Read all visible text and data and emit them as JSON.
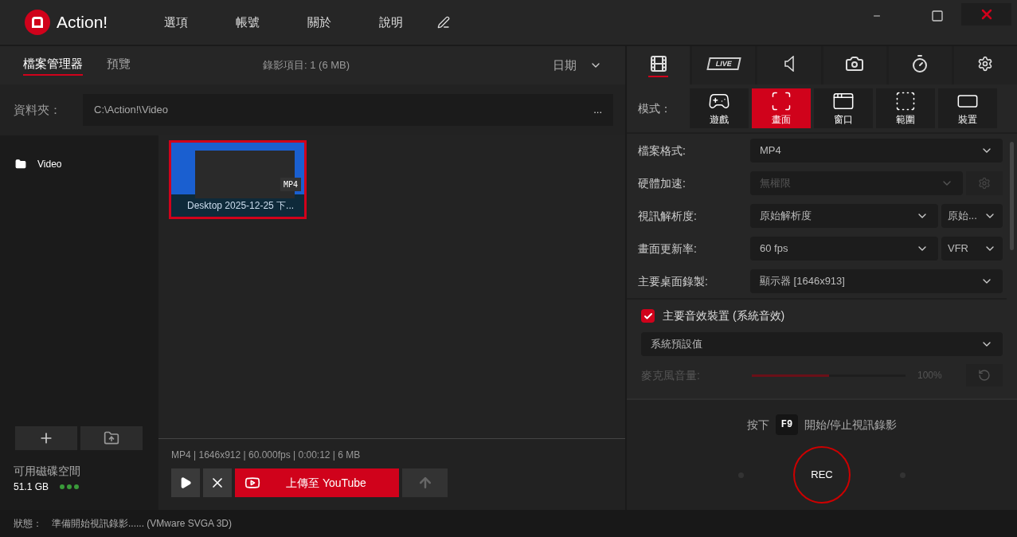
{
  "title_bar": {
    "app_name": "Action!",
    "menu": [
      "選項",
      "帳號",
      "關於",
      "說明"
    ]
  },
  "file_panel": {
    "tabs": [
      {
        "label": "檔案管理器",
        "selected": true
      },
      {
        "label": "預覽",
        "selected": false
      }
    ],
    "record_count": "錄影項目: 1 (6 MB)",
    "sort": "日期",
    "folder": {
      "label": "資料夾：",
      "value": "C:\\Action!\\Video",
      "more": "..."
    },
    "folders": [
      {
        "name": "Video"
      }
    ],
    "disk": {
      "label": "可用磁碟空間",
      "value": "51.1 GB"
    },
    "recordings": [
      {
        "title": "Desktop 2025-12-25 下...",
        "format": "MP4",
        "selected": true
      }
    ],
    "info": "MP4 | 1646x912 | 60.000fps | 0:00:12 | 6 MB",
    "upload_button": "上傳至 YouTube"
  },
  "settings_panel": {
    "tabs": [
      {
        "kind": "video",
        "selected": true
      },
      {
        "kind": "live",
        "label": "LIVE",
        "selected": false
      },
      {
        "kind": "audio",
        "selected": false
      },
      {
        "kind": "screenshot",
        "selected": false
      },
      {
        "kind": "timer",
        "selected": false
      },
      {
        "kind": "settings",
        "selected": false
      }
    ],
    "mode_label": "模式：",
    "modes": [
      {
        "kind": "game",
        "label": "遊戲",
        "selected": false
      },
      {
        "kind": "screen",
        "label": "畫面",
        "selected": true
      },
      {
        "kind": "window",
        "label": "窗口",
        "selected": false
      },
      {
        "kind": "region",
        "label": "範圍",
        "selected": false
      },
      {
        "kind": "device",
        "label": "裝置",
        "selected": false
      }
    ],
    "fields": [
      {
        "kind": "select",
        "label": "檔案格式:",
        "value": "MP4",
        "disabled": false
      },
      {
        "kind": "select_gear",
        "label": "硬體加速:",
        "value": "無權限",
        "disabled": true
      },
      {
        "kind": "select_pair",
        "label": "視訊解析度:",
        "value": "原始解析度",
        "value2": "原始...",
        "disabled": false
      },
      {
        "kind": "select_pair",
        "label": "畫面更新率:",
        "value": "60 fps",
        "value2": "VFR",
        "disabled": false
      },
      {
        "kind": "select",
        "label": "主要桌面錄製:",
        "value": "顯示器 [1646x913]",
        "disabled": false
      }
    ],
    "audio": {
      "checked": true,
      "label": "主要音效裝置 (系統音效)",
      "device": "系統預設值",
      "volume": {
        "label": "麥克風音量:",
        "level": 0.5,
        "reading": "100%",
        "disabled": true
      }
    },
    "hotkey": {
      "prefix": "按下",
      "key": "F9",
      "suffix": "開始/停止視訊錄影"
    },
    "rec_button": "REC"
  },
  "status_bar": {
    "label": "狀態：",
    "text": "準備開始視訊錄影...... (VMware SVGA 3D)"
  }
}
